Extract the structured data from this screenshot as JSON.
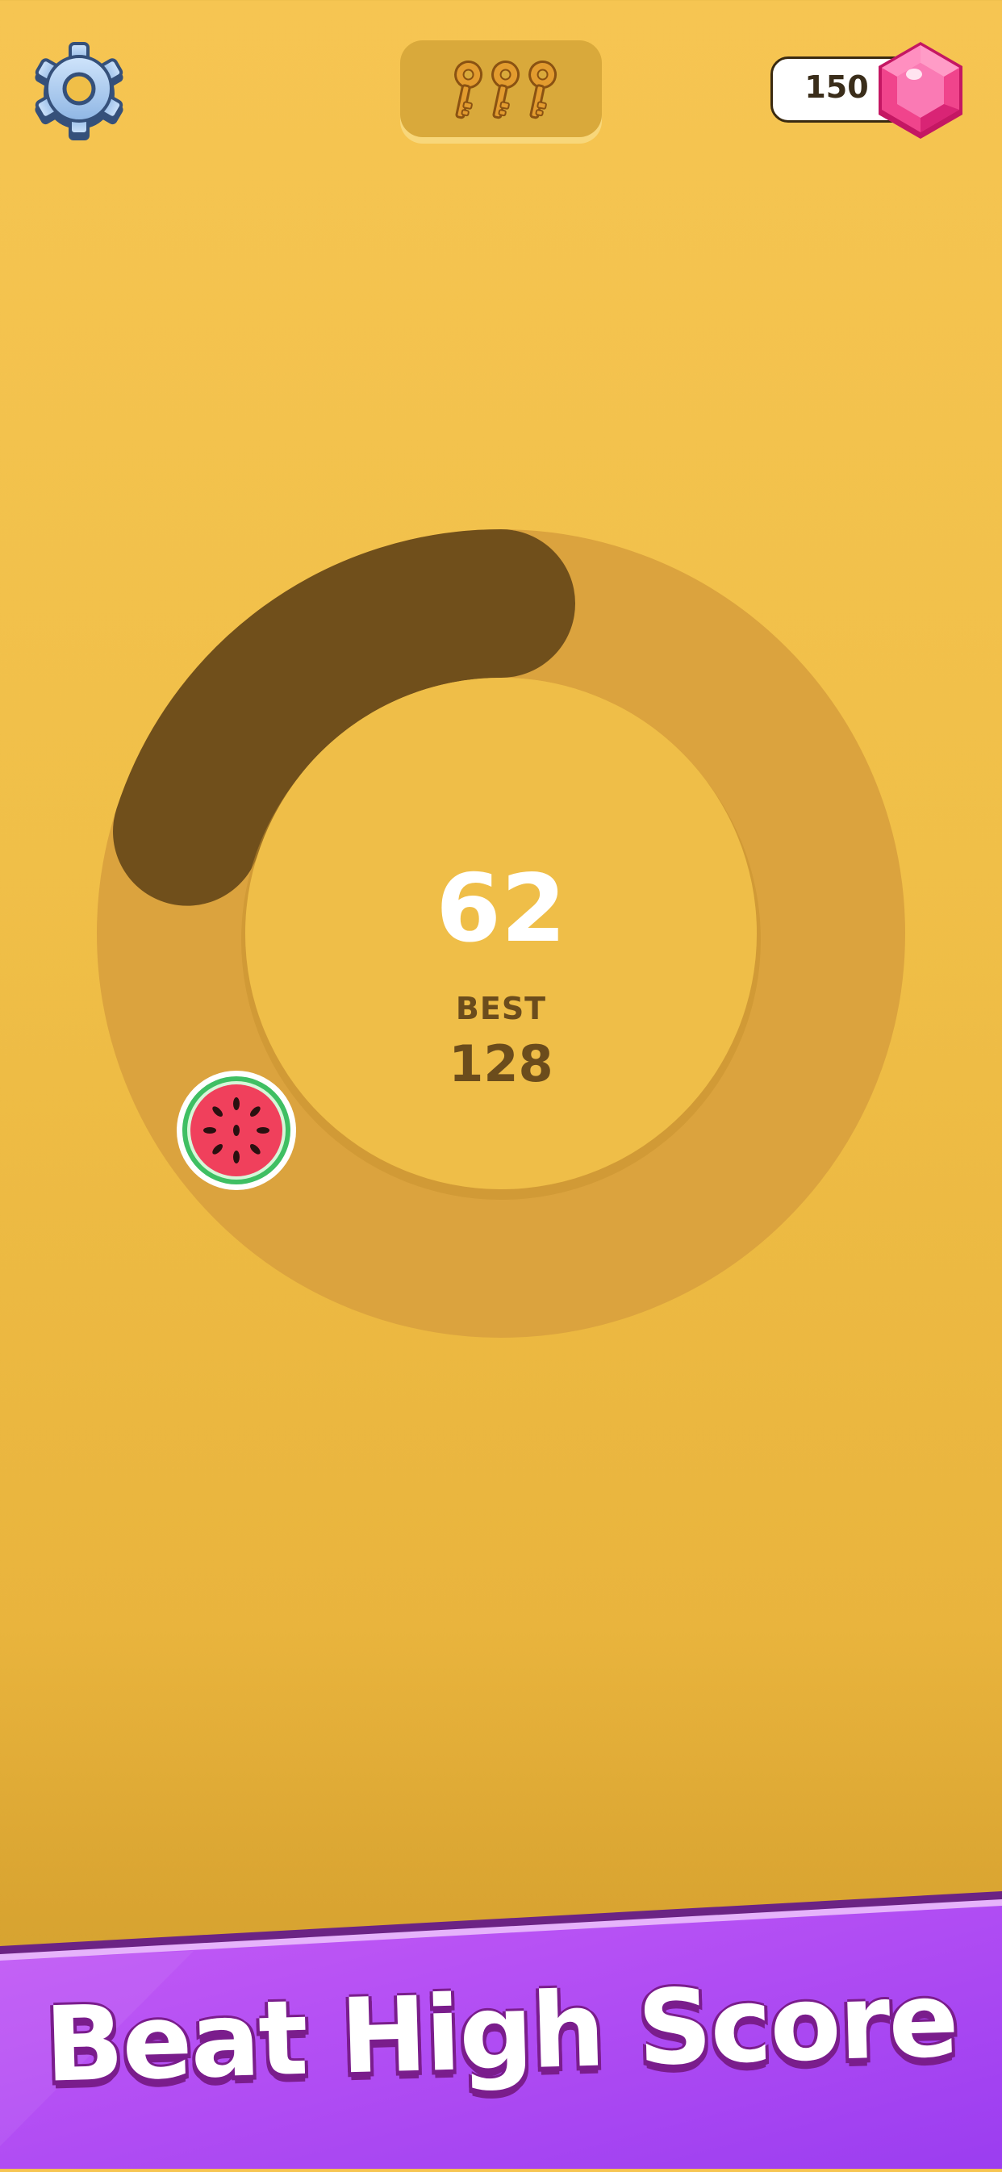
{
  "header": {
    "settings_icon": "gear-icon",
    "keys_icon": "key-icon",
    "keys_count": 3,
    "gems": "150",
    "gem_icon": "pink-hexagon-gem-icon"
  },
  "game": {
    "score": "62",
    "best_label": "BEST",
    "best_value": "128",
    "progress_fraction": 0.2,
    "player_icon": "watermelon-slice-icon"
  },
  "banner": {
    "text": "Beat High Score"
  },
  "colors": {
    "background": "#f0bf48",
    "ring_track": "#dba33e",
    "ring_filled": "#704f1b",
    "inner_disc": "#efbe48",
    "banner": "#b14ef2",
    "banner_outline": "#7a1d8c",
    "gem": "#f0448c"
  }
}
